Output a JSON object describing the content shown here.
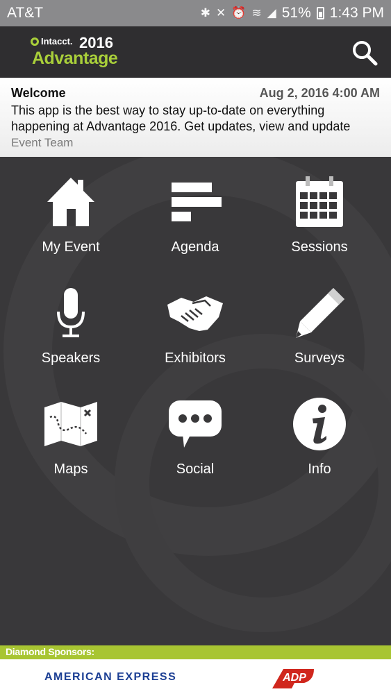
{
  "status_bar": {
    "carrier": "AT&T",
    "battery": "51%",
    "time": "1:43 PM"
  },
  "header": {
    "brand": "Intacct.",
    "year": "2016",
    "event_name": "Advantage",
    "search_icon": "search-icon"
  },
  "notice": {
    "title": "Welcome",
    "date": "Aug 2, 2016 4:00 AM",
    "body": "This app is the best way to stay up-to-date on everything happening at Advantage 2016. Get updates, view and update",
    "author": "Event Team"
  },
  "menu": [
    {
      "label": "My Event",
      "icon": "house-icon"
    },
    {
      "label": "Agenda",
      "icon": "agenda-bars-icon"
    },
    {
      "label": "Sessions",
      "icon": "calendar-icon"
    },
    {
      "label": "Speakers",
      "icon": "microphone-icon"
    },
    {
      "label": "Exhibitors",
      "icon": "handshake-icon"
    },
    {
      "label": "Surveys",
      "icon": "pencil-icon"
    },
    {
      "label": "Maps",
      "icon": "map-icon"
    },
    {
      "label": "Social",
      "icon": "chat-bubble-icon"
    },
    {
      "label": "Info",
      "icon": "info-icon"
    }
  ],
  "sponsors": {
    "heading": "Diamond Sponsors:",
    "items": [
      "AMERICAN EXPRESS",
      "ADP"
    ]
  },
  "colors": {
    "accent_green": "#a9cf3a",
    "background": "#39383a",
    "header": "#2f2e30"
  }
}
